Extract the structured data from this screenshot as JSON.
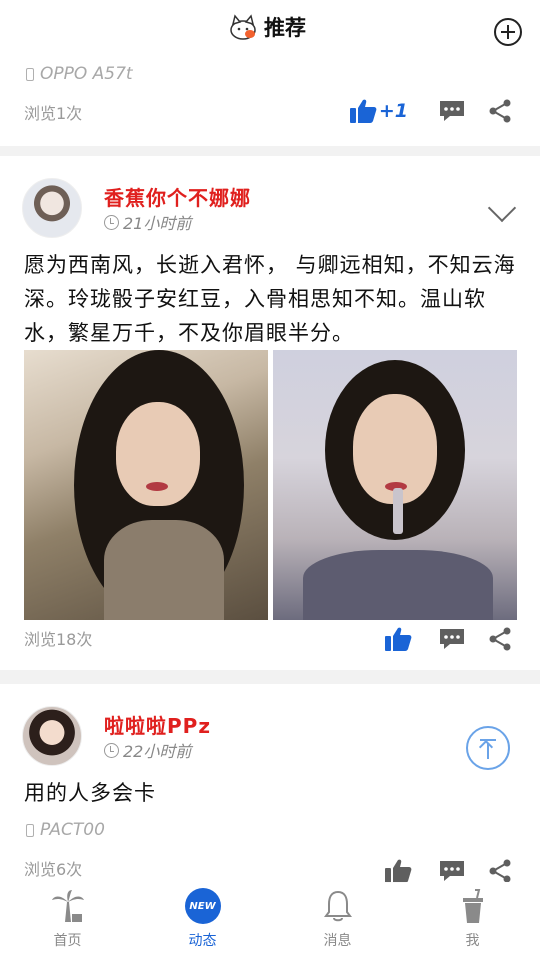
{
  "header": {
    "title": "推荐"
  },
  "post1": {
    "device": "OPPO A57t",
    "views": "浏览1次",
    "like_count": "+1"
  },
  "post2": {
    "username": "香蕉你个不娜娜",
    "time": "21小时前",
    "text": "愿为西南风，长逝入君怀， 与卿远相知，不知云海深。玲珑骰子安红豆，入骨相思知不知。温山软水，繁星万千，不及你眉眼半分。",
    "views": "浏览18次"
  },
  "post3": {
    "username": "啦啦啦PPz",
    "time": "22小时前",
    "text": "用的人多会卡",
    "device": "PACT00",
    "views": "浏览6次"
  },
  "nav": {
    "items": [
      {
        "label": "首页",
        "icon": "palm-tree-icon"
      },
      {
        "label": "动态",
        "icon": "new-badge-icon",
        "badge": "NEW",
        "active": true
      },
      {
        "label": "消息",
        "icon": "bell-icon"
      },
      {
        "label": "我",
        "icon": "cup-icon"
      }
    ]
  },
  "colors": {
    "accent": "#1a64d6",
    "username": "#e0201e"
  }
}
